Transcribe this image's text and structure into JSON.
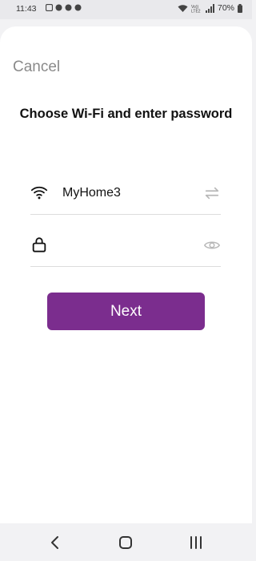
{
  "status_bar": {
    "time": "11:43",
    "battery": "70%",
    "icons": [
      "notification-icon",
      "wifi-icon",
      "signal-icon",
      "volte-icon",
      "battery-icon"
    ]
  },
  "sheet": {
    "cancel_label": "Cancel",
    "title": "Choose Wi-Fi and enter password",
    "ssid": "MyHome3",
    "password_value": "",
    "password_placeholder": "",
    "next_label": "Next"
  },
  "colors": {
    "accent": "#7b2d8e",
    "cancel_text": "#8a8a8a",
    "divider": "#dcdcdc"
  },
  "nav_bar": {
    "icons": [
      "back-icon",
      "home-icon",
      "recents-icon"
    ]
  }
}
